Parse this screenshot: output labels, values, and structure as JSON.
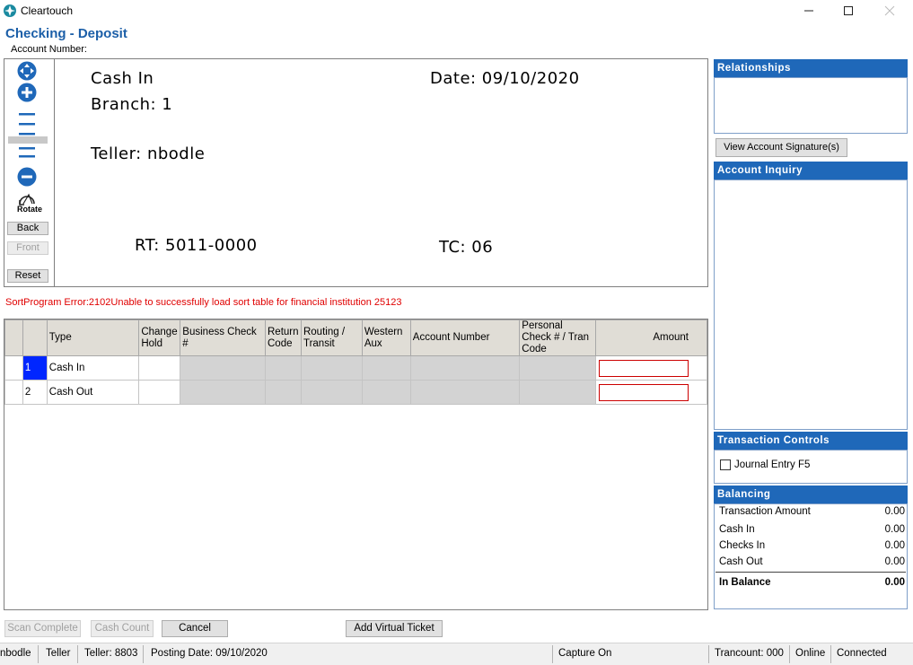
{
  "window": {
    "app_title": "Cleartouch"
  },
  "screen": {
    "title": "Checking - Deposit",
    "account_number_label": "Account Number:"
  },
  "viewer": {
    "rotate_label": "Rotate",
    "back_button": "Back",
    "front_button": "Front",
    "reset_button": "Reset",
    "check": {
      "line1": "Cash In",
      "date": "Date: 09/10/2020",
      "branch": "Branch: 1",
      "teller": "Teller: nbodle",
      "rt": "RT: 5011-0000",
      "tc": "TC: 06"
    }
  },
  "error_message": "SortProgram Error:2102Unable to successfully load sort table for financial institution 25123",
  "grid": {
    "headers": {
      "type": "Type",
      "change_hold": "Change Hold",
      "business_check": "Business Check #",
      "return_code": "Return Code",
      "routing_transit": "Routing / Transit",
      "western_aux": "Western Aux",
      "account_number": "Account Number",
      "personal_check": "Personal Check # / Tran Code",
      "amount": "Amount"
    },
    "rows": [
      {
        "num": "1",
        "type": "Cash In",
        "amount": ""
      },
      {
        "num": "2",
        "type": "Cash Out",
        "amount": ""
      }
    ]
  },
  "right_panel": {
    "relationships_header": "Relationships",
    "view_signature_button": "View Account Signature(s)",
    "account_inquiry_header": "Account Inquiry",
    "transaction_controls_header": "Transaction Controls",
    "journal_entry_label": "Journal Entry F5",
    "journal_entry_checked": false,
    "balancing_header": "Balancing",
    "balancing": {
      "transaction_amount_label": "Transaction Amount",
      "transaction_amount": "0.00",
      "cash_in_label": "Cash In",
      "cash_in": "0.00",
      "checks_in_label": "Checks In",
      "checks_in": "0.00",
      "cash_out_label": "Cash Out",
      "cash_out": "0.00",
      "in_balance_label": "In Balance",
      "in_balance": "0.00"
    }
  },
  "buttons": {
    "scan_complete": "Scan Complete",
    "cash_count": "Cash Count",
    "cancel": "Cancel",
    "add_virtual_ticket": "Add Virtual Ticket"
  },
  "status_bar": {
    "user": "nbodle",
    "role": "Teller",
    "teller_no": "Teller: 8803",
    "posting_date": "Posting Date: 09/10/2020",
    "capture": "Capture On",
    "trancount": "Trancount: 000",
    "online": "Online",
    "connected": "Connected"
  },
  "colors": {
    "accent": "#1f68b9",
    "title": "#1c5fa8",
    "error": "#e00000",
    "selected_row": "#0026ff"
  }
}
